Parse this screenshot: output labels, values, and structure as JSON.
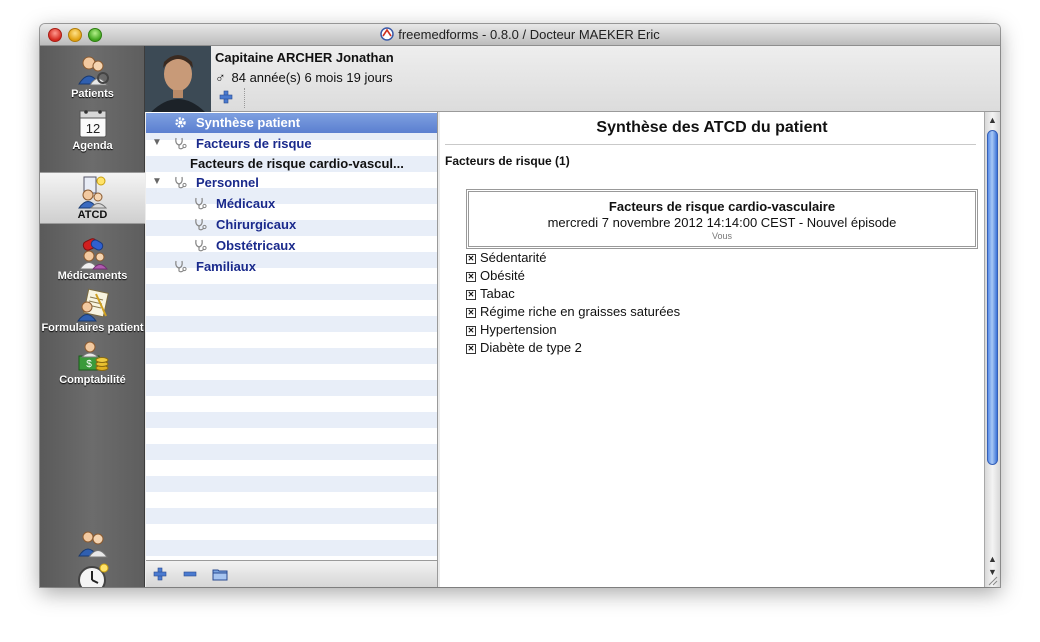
{
  "window": {
    "title": "freemedforms - 0.8.0 / Docteur MAEKER Eric"
  },
  "sidebar": {
    "items": [
      {
        "label": "Patients",
        "icon": "patients-icon"
      },
      {
        "label": "Agenda",
        "icon": "agenda-icon",
        "day": "12"
      },
      {
        "label": "ATCD",
        "icon": "atcd-icon",
        "active": true
      },
      {
        "label": "Médicaments",
        "icon": "medications-icon"
      },
      {
        "label": "Formulaires patient",
        "icon": "patient-forms-icon"
      },
      {
        "label": "Comptabilité",
        "icon": "accounting-icon"
      }
    ],
    "bottom_icons": [
      "user-switch-icon",
      "clock-icon"
    ]
  },
  "patient": {
    "name": "Capitaine ARCHER Jonathan",
    "gender_symbol": "♂",
    "age": "84 année(s) 6 mois 19 jours"
  },
  "tree": {
    "rows": [
      {
        "label": "Synthèse patient",
        "selected": true
      },
      {
        "label": "Facteurs de risque",
        "expanded": true
      },
      {
        "label": "Facteurs de risque cardio-vascul..."
      },
      {
        "label": "Personnel",
        "expanded": true
      },
      {
        "label": "Médicaux"
      },
      {
        "label": "Chirurgicaux"
      },
      {
        "label": "Obstétricaux"
      },
      {
        "label": "Familiaux"
      }
    ]
  },
  "content": {
    "title": "Synthèse des ATCD du patient",
    "section_title": "Facteurs de risque (1)",
    "episode": {
      "title": "Facteurs de risque cardio-vasculaire",
      "date": "mercredi 7 novembre 2012 14:14:00 CEST - Nouvel épisode",
      "user": "Vous"
    },
    "items": [
      "Sédentarité",
      "Obésité",
      "Tabac",
      "Régime riche en graisses saturées",
      "Hypertension",
      "Diabète de type 2"
    ],
    "check_glyph": "✕"
  },
  "colors": {
    "selection": "#5b7fd0",
    "tree_text": "#1a2a8c",
    "sidebar": "#5e5e5e",
    "scroll_thumb": "#5a8ee8"
  }
}
